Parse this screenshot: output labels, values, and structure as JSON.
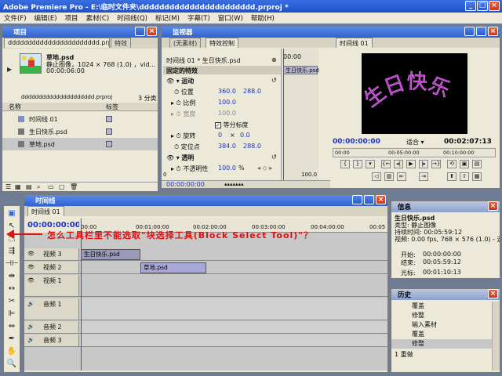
{
  "app": {
    "title": "Adobe Premiere Pro - E:\\临时文件夹\\ddddddddddddddddddddddd.prproj *",
    "min": "_",
    "max": "□",
    "close": "×"
  },
  "menu": [
    "文件(F)",
    "编辑(E)",
    "项目",
    "素材(C)",
    "时间线(Q)",
    "标记(M)",
    "字幕(T)",
    "窗口(W)",
    "帮助(H)"
  ],
  "project": {
    "title": "项目",
    "tab_active": "ddddddddddddddddddddddd.prproj",
    "tab2": "特效",
    "clip_name": "草地.psd",
    "clip_info1": "静止图像，1024 × 768 (1.0) ，vid...",
    "clip_info2": "00:00:06:00",
    "folder": "ddddddddddddddddddddd.prproj",
    "count": "3 分类",
    "col_name": "名称",
    "col_label": "标签",
    "items": [
      {
        "name": "时间线 01"
      },
      {
        "name": "生日快乐.psd"
      },
      {
        "name": "草地.psd"
      }
    ]
  },
  "monitor": {
    "title": "监视器",
    "tab_none": "(无素材)",
    "tab_fx": "特效控制",
    "tab_program": "时间线 01",
    "fx_header": "时间线 01 * 生日快乐.psd",
    "fx_time": "00:00",
    "fixed": "固定的特效",
    "fx_clip": "生日快乐.psd",
    "motion": "运动",
    "position": "位置",
    "pos_x": "360.0",
    "pos_y": "288.0",
    "scale": "比例",
    "scale_v": "100.0",
    "width": "宽度",
    "width_v": "100.0",
    "uniform": "等分标度",
    "rotate": "旋转",
    "rot_a": "0",
    "rot_b": "0.0",
    "anchor": "定位点",
    "anc_x": "384.0",
    "anc_y": "288.0",
    "opacity": "透明",
    "opacity_label": "不透明性",
    "opacity_v": "100.0",
    "percent": "%",
    "bottom_time": "00:00:00:00",
    "scale_max": "100.0",
    "zero": "0",
    "program_text": "生日快乐",
    "tc_left": "00:00:00:00",
    "fit": "适合",
    "tc_right": "00:02:07:13",
    "ruler": [
      "00:00",
      "00:05:00:00",
      "00:10:00:00"
    ]
  },
  "timeline": {
    "title": "时间线",
    "tab": "时间线 01",
    "timecode": "00:00:00:00",
    "ruler": [
      "00:00",
      "00:01:00:00",
      "00:02:00:00",
      "00:03:00:00",
      "00:04:00:00",
      "00:05"
    ],
    "annotation": "怎么工具栏里不能选取\"块选择工具(Block Select Tool)\"？",
    "tracks": [
      {
        "name": "视频 3",
        "clip": "生日快乐.psd"
      },
      {
        "name": "视频 2",
        "clip": "草地.psd"
      },
      {
        "name": "视频 1",
        "clip": ""
      },
      {
        "name": "音频 1",
        "clip": ""
      },
      {
        "name": "音频 2",
        "clip": ""
      },
      {
        "name": "音频 3",
        "clip": ""
      }
    ]
  },
  "info": {
    "title": "信息",
    "name": "生日快乐.psd",
    "type": "类型: 静止图像",
    "duration": "持续时间: 00:05:59:12",
    "video": "视频: 0.00 fps, 768 × 576 (1.0) - 透明",
    "start_label": "开始:",
    "start": "00:00:00:00",
    "end_label": "结束:",
    "end": "00:05:59:12",
    "cursor_label": "光标:",
    "cursor": "00:01:10:13"
  },
  "history": {
    "title": "历史",
    "items": [
      "覆盖",
      "修整",
      "输入素材",
      "覆盖",
      "修整"
    ],
    "undo": "1 重做"
  },
  "colors": {
    "titlebar": "#2f63d2",
    "panel": "#ece9d8",
    "annotation": "#e01010"
  }
}
